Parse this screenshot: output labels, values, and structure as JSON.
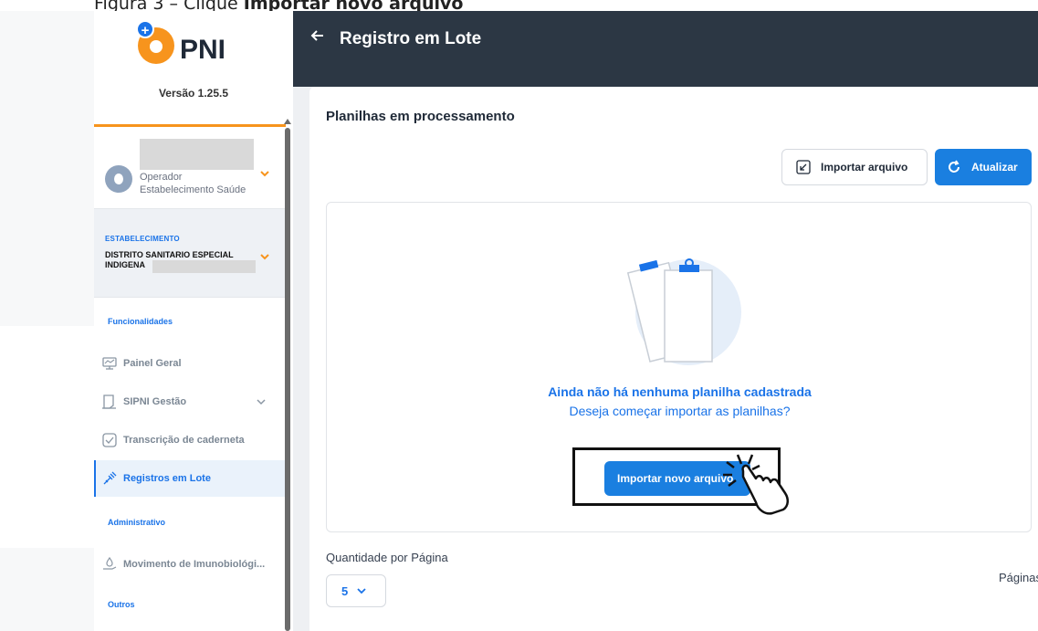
{
  "caption": {
    "prefix": "Figura 3 – Clique ",
    "bold": "Importar novo arquivo"
  },
  "app": {
    "logo_text": "PNI",
    "version": "Versão 1.25.5"
  },
  "user": {
    "role_line1": "Operador",
    "role_line2": "Estabelecimento Saúde"
  },
  "establishment": {
    "label": "ESTABELECIMENTO",
    "name_line1": "DISTRITO SANITARIO ESPECIAL",
    "name_line2": "INDIGENA"
  },
  "sidebar": {
    "section_functionalities": "Funcionalidades",
    "section_admin": "Administrativo",
    "section_others": "Outros",
    "items": [
      {
        "label": "Painel Geral",
        "icon": "monitor-icon"
      },
      {
        "label": "SIPNI Gestão",
        "icon": "document-icon"
      },
      {
        "label": "Transcrição de caderneta",
        "icon": "checkbox-icon"
      },
      {
        "label": "Registros em Lote",
        "icon": "syringe-icon",
        "active": true
      },
      {
        "label": "Movimento de Imunobiológi...",
        "icon": "hand-drop-icon"
      }
    ]
  },
  "header": {
    "title": "Registro em Lote"
  },
  "card": {
    "title": "Planilhas em processamento",
    "import_button": "Importar arquivo",
    "refresh_button": "Atualizar",
    "empty_title": "Ainda não há nenhuma planilha cadastrada",
    "empty_subtitle": "Deseja começar importar as planilhas?",
    "new_import_button": "Importar novo arquivo"
  },
  "pagination": {
    "per_page_label": "Quantidade por Página",
    "per_page_value": "5",
    "pages_label": "Páginas"
  },
  "colors": {
    "accent": "#1a7fe0",
    "header": "#2c3744",
    "brand_orange": "#f7941d"
  }
}
